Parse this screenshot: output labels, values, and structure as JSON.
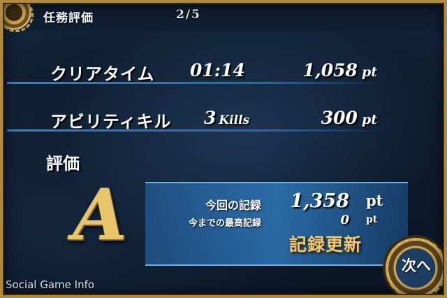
{
  "header": {
    "title": "任務評価",
    "page": "2/5"
  },
  "results": [
    {
      "label": "クリアタイム",
      "value": "01:14",
      "value_unit": "",
      "points": "1,058",
      "points_unit": "pt"
    },
    {
      "label": "アビリティキル",
      "value": "3",
      "value_unit": "Kills",
      "points": "300",
      "points_unit": "pt"
    }
  ],
  "evaluation": {
    "heading": "評価",
    "grade": "A",
    "current_label": "今回の記録",
    "current_points": "1,358",
    "current_unit": "pt",
    "best_label": "今までの最高記録",
    "best_points": "0",
    "best_unit": "pt",
    "record_badge": "記録更新"
  },
  "next_button": {
    "label": "次へ"
  },
  "watermark": "Social Game Info",
  "colors": {
    "gold": "#e9c66a",
    "panel_blue": "#3282c8",
    "frame_gold": "#b28a3e"
  }
}
